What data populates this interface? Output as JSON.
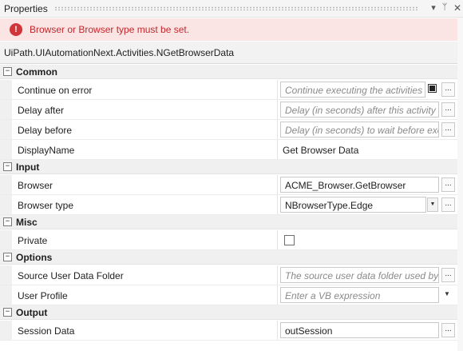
{
  "panel": {
    "title": "Properties",
    "dropdown_icon": "▾",
    "pin_icon": "ᛘ",
    "close_icon": "✕"
  },
  "error": {
    "icon": "!",
    "message": "Browser or Browser type must be set."
  },
  "activity_type": "UiPath.UIAutomationNext.Activities.NGetBrowserData",
  "colors": {
    "error_bg": "#fbe4e4",
    "error_text": "#c4262b",
    "error_icon": "#d13438",
    "category_bg": "#f0f0f0"
  },
  "categories": {
    "common": {
      "label": "Common",
      "toggle": "−",
      "continue_on_error": {
        "label": "Continue on error",
        "placeholder": "Continue executing the activities",
        "button": "..."
      },
      "delay_after": {
        "label": "Delay after",
        "placeholder": "Delay (in seconds) after this activity i",
        "button": "..."
      },
      "delay_before": {
        "label": "Delay before",
        "placeholder": "Delay (in seconds) to wait before exe",
        "button": "..."
      },
      "display_name": {
        "label": "DisplayName",
        "value": "Get Browser Data"
      }
    },
    "input": {
      "label": "Input",
      "toggle": "−",
      "browser": {
        "label": "Browser",
        "value": "ACME_Browser.GetBrowser",
        "button": "..."
      },
      "browser_type": {
        "label": "Browser type",
        "value": "NBrowserType.Edge",
        "arrow": "▼",
        "button": "..."
      }
    },
    "misc": {
      "label": "Misc",
      "toggle": "−",
      "private": {
        "label": "Private",
        "checked": false
      }
    },
    "options": {
      "label": "Options",
      "toggle": "−",
      "source_user_data_folder": {
        "label": "Source User Data Folder",
        "placeholder": "The source user data folder used by t",
        "button": "..."
      },
      "user_profile": {
        "label": "User Profile",
        "placeholder": "Enter a VB expression",
        "arrow": "▼"
      }
    },
    "output": {
      "label": "Output",
      "toggle": "−",
      "session_data": {
        "label": "Session Data",
        "value": "outSession",
        "button": "..."
      }
    }
  }
}
